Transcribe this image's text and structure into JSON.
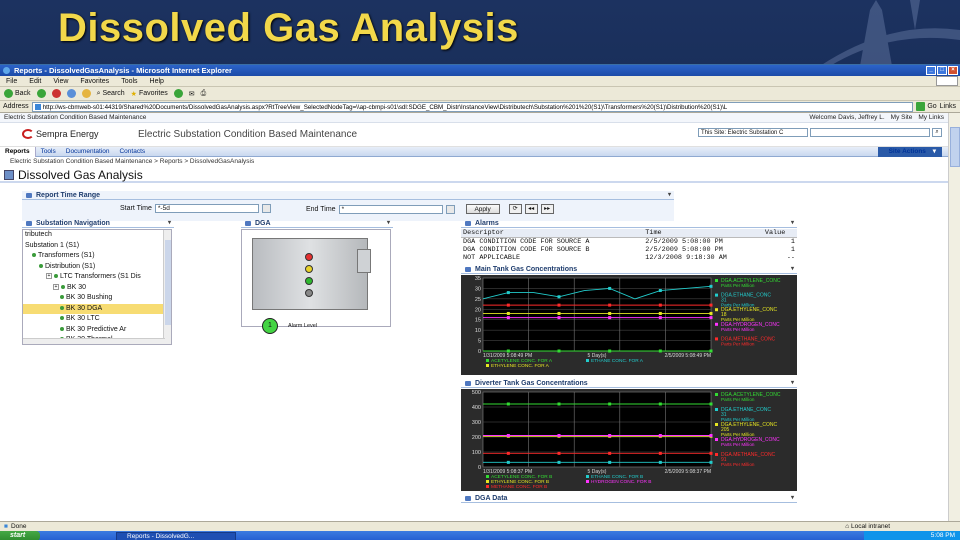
{
  "slide": {
    "title": "Dissolved Gas Analysis"
  },
  "browser": {
    "window_title": "Reports - DissolvedGasAnalysis - Microsoft Internet Explorer",
    "menu": [
      "File",
      "Edit",
      "View",
      "Favorites",
      "Tools",
      "Help"
    ],
    "toolbar": {
      "back": "Back",
      "search": "Search",
      "favorites": "Favorites"
    },
    "address_label": "Address",
    "address": "http://ws-cbmweb-s01:44319/Shared%20Documents/DissolvedGasAnalysis.aspx?RtTreeView_SelectedNodeTag=\\\\ap-cbmpi-s01\\sdl:SDGE_CBM_Distr\\InstanceView\\Distributech\\Substation%201%20(S1)\\Transformers%20(S1)\\Distribution%20(S1)\\L",
    "go": "Go",
    "links": "Links",
    "status": "Done",
    "zone": "Local intranet"
  },
  "sharepoint": {
    "top_left": "Electric Substation Condition Based Maintenance",
    "welcome": "Welcome Davis, Jeffrey L.",
    "my_site": "My Site",
    "my_links": "My Links",
    "logo": "Sempra Energy",
    "site_title": "Electric Substation Condition Based Maintenance",
    "search_scope": "This Site: Electric Substation C",
    "tabs": [
      "Reports",
      "Tools",
      "Documentation",
      "Contacts"
    ],
    "site_actions": "Site Actions",
    "breadcrumb": "Electric Substation Condition Based Maintenance > Reports > DissolvedGasAnalysis",
    "page_title": "Dissolved Gas Analysis"
  },
  "report_time": {
    "header": "Report Time Range",
    "start_label": "Start Time",
    "start_value": "*-5d",
    "end_label": "End Time",
    "end_value": "*",
    "apply": "Apply"
  },
  "substation_nav": {
    "header": "Substation Navigation",
    "items": [
      {
        "label": "tributech",
        "level": 0,
        "selected": false
      },
      {
        "label": "Substation 1 (S1)",
        "level": 0,
        "selected": false
      },
      {
        "label": "Transformers (S1)",
        "level": 1,
        "selected": false
      },
      {
        "label": "Distribution (S1)",
        "level": 2,
        "selected": false
      },
      {
        "label": "LTC Transformers (S1 Dis",
        "level": 3,
        "selected": false
      },
      {
        "label": "BK 30",
        "level": 4,
        "selected": false
      },
      {
        "label": "BK 30 Bushing",
        "level": 5,
        "selected": false
      },
      {
        "label": "BK 30 DGA",
        "level": 5,
        "selected": true
      },
      {
        "label": "BK 30 LTC",
        "level": 5,
        "selected": false
      },
      {
        "label": "BK 30 Predictive Ar",
        "level": 5,
        "selected": false
      },
      {
        "label": "BK 30 Thermal",
        "level": 5,
        "selected": false
      },
      {
        "label": "BK 31",
        "level": 4,
        "selected": false
      }
    ]
  },
  "dga_panel": {
    "header": "DGA",
    "alarm_level_value": "1",
    "alarm_level_label": "Alarm Level"
  },
  "alarms": {
    "header": "Alarms",
    "columns": [
      "Descriptor",
      "Time",
      "Value"
    ],
    "rows": [
      [
        "DGA CONDITION CODE FOR SOURCE A",
        "2/5/2009 5:08:00 PM",
        "1"
      ],
      [
        "DGA CONDITION CODE FOR SOURCE B",
        "2/5/2009 5:08:00 PM",
        "1"
      ],
      [
        "NOT APPLICABLE",
        "12/3/2008 9:18:30 AM",
        "--"
      ]
    ]
  },
  "colors": {
    "slide_title": "#f2d84a",
    "chart_bg": "#000000",
    "acetylene": "#33dd33",
    "ethane": "#22cccc",
    "ethylene": "#e6e622",
    "methane": "#ff33ff",
    "red": "#ff2a2a"
  },
  "chart_data": [
    {
      "type": "line",
      "title": "Main Tank Gas Concentrations",
      "ylim": [
        0,
        35
      ],
      "yticks": [
        0,
        5,
        10,
        15,
        20,
        25,
        30,
        35
      ],
      "x_start": "1/31/2009 5:08:49 PM",
      "x_span": "5 Day(s)",
      "x_end": "2/5/2009 5:08:49 PM",
      "legend": [
        {
          "label": "ACETYLENE CONC. FOR A",
          "color": "#33dd33"
        },
        {
          "label": "ETHANE CONC. FOR A",
          "color": "#22cccc"
        },
        {
          "label": "ETHYLENE CONC. FOR A",
          "color": "#e6e622"
        }
      ],
      "series": [
        {
          "name": "DGA.ACETYLENE_CONC",
          "unit": "Parts Per Million",
          "color": "#33dd33",
          "values": [
            0,
            0,
            0,
            0,
            0,
            0,
            0,
            0,
            0,
            0
          ]
        },
        {
          "name": "DGA.ETHANE_CONC",
          "value": "31",
          "unit": "Parts Per Million",
          "color": "#22cccc",
          "values": [
            25,
            28,
            28,
            26,
            29,
            30,
            25,
            29,
            30,
            31
          ]
        },
        {
          "name": "DGA.ETHYLENE_CONC",
          "value": "18",
          "unit": "Parts Per Million",
          "color": "#e6e622",
          "values": [
            18,
            18,
            18,
            18,
            18,
            18,
            18,
            18,
            18,
            18
          ]
        },
        {
          "name": "DGA.HYDROGEN_CONC",
          "unit": "Parts Per Million",
          "color": "#ff33ff",
          "values": [
            16,
            16,
            16,
            16,
            16,
            16,
            16,
            16,
            16,
            16
          ]
        },
        {
          "name": "DGA.METHANE_CONC",
          "unit": "Parts Per Million",
          "color": "#ff2a2a",
          "values": [
            22,
            22,
            22,
            22,
            22,
            22,
            22,
            22,
            22,
            22
          ]
        }
      ]
    },
    {
      "type": "line",
      "title": "Diverter Tank Gas Concentrations",
      "ylim": [
        0,
        500
      ],
      "yticks": [
        0,
        100,
        200,
        300,
        400,
        500
      ],
      "x_start": "1/31/2009 5:08:37 PM",
      "x_span": "5 Day(s)",
      "x_end": "2/5/2009 5:08:37 PM",
      "legend": [
        {
          "label": "ACETYLENE CONC. FOR B",
          "color": "#33dd33"
        },
        {
          "label": "ETHANE CONC. FOR B",
          "color": "#22cccc"
        },
        {
          "label": "ETHYLENE CONC. FOR B",
          "color": "#e6e622"
        },
        {
          "label": "HYDROGEN CONC. FOR B",
          "color": "#ff33ff"
        },
        {
          "label": "METHANE CONC. FOR B",
          "color": "#ff2a2a"
        }
      ],
      "series": [
        {
          "name": "DGA.ACETYLENE_CONC",
          "unit": "Parts Per Million",
          "color": "#33dd33",
          "values": [
            420,
            420,
            420,
            420,
            420,
            420,
            420,
            420,
            420,
            420
          ]
        },
        {
          "name": "DGA.ETHANE_CONC",
          "value": "31",
          "unit": "Parts Per Million",
          "color": "#22cccc",
          "values": [
            31,
            31,
            31,
            31,
            31,
            31,
            31,
            31,
            31,
            31
          ]
        },
        {
          "name": "DGA.ETHYLENE_CONC",
          "value": "205",
          "unit": "Parts Per Million",
          "color": "#e6e622",
          "values": [
            205,
            205,
            205,
            205,
            205,
            205,
            205,
            205,
            205,
            205
          ]
        },
        {
          "name": "DGA.HYDROGEN_CONC",
          "unit": "Parts Per Million",
          "color": "#ff33ff",
          "values": [
            210,
            210,
            210,
            210,
            210,
            210,
            210,
            210,
            210,
            210
          ]
        },
        {
          "name": "DGA.METHANE_CONC",
          "value": "91",
          "unit": "Parts Per Million",
          "color": "#ff2a2a",
          "values": [
            91,
            91,
            91,
            91,
            91,
            91,
            91,
            91,
            91,
            91
          ]
        }
      ]
    }
  ],
  "dga_data": {
    "header": "DGA Data"
  },
  "taskbar": {
    "start": "start",
    "task": "Reports - DissolvedG...",
    "clock": "5:08 PM"
  }
}
